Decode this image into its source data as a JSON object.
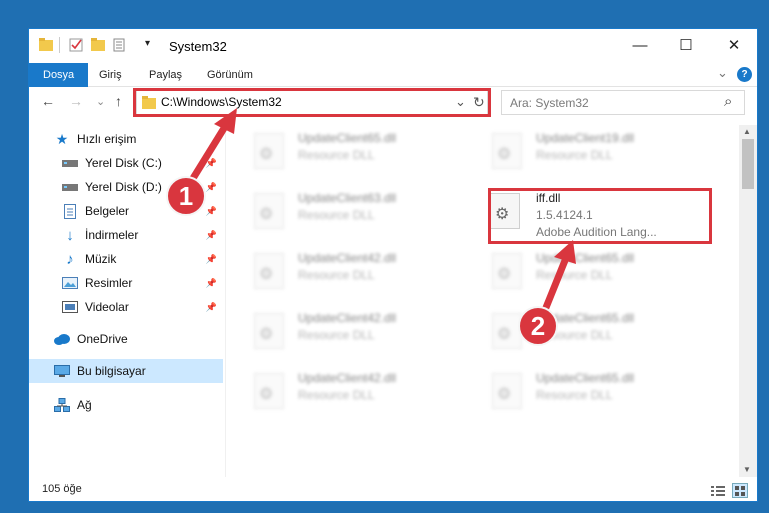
{
  "window": {
    "title": "System32",
    "minimize": "—",
    "maximize": "☐",
    "close": "✕"
  },
  "ribbon": {
    "tabs": [
      "Dosya",
      "Giriş",
      "Paylaş",
      "Görünüm"
    ],
    "expand": "⌄",
    "help": "?"
  },
  "nav": {
    "back": "←",
    "forward": "→",
    "recent": "⌄",
    "up": "↑",
    "address": "C:\\Windows\\System32",
    "dropdown": "⌄",
    "refresh": "↻",
    "search_placeholder": "Ara: System32",
    "search_icon": "⌕"
  },
  "sidebar": {
    "items": [
      {
        "label": "Hızlı erişim",
        "icon": "star-icon"
      },
      {
        "label": "Yerel Disk (C:)",
        "icon": "drive-icon"
      },
      {
        "label": "Yerel Disk (D:)",
        "icon": "drive-icon"
      },
      {
        "label": "Belgeler",
        "icon": "documents-icon"
      },
      {
        "label": "İndirmeler",
        "icon": "download-icon"
      },
      {
        "label": "Müzik",
        "icon": "music-icon"
      },
      {
        "label": "Resimler",
        "icon": "pictures-icon"
      },
      {
        "label": "Videolar",
        "icon": "video-icon"
      },
      {
        "label": "OneDrive",
        "icon": "cloud-icon"
      },
      {
        "label": "Bu bilgisayar",
        "icon": "computer-icon"
      },
      {
        "label": "Ağ",
        "icon": "network-icon"
      }
    ]
  },
  "files": {
    "left": [
      {
        "name": "UpdateClient65.dll",
        "desc": "Resource DLL"
      },
      {
        "name": "UpdateClient63.dll",
        "desc": "Resource DLL"
      },
      {
        "name": "UpdateClient42.dll",
        "desc": "Resource DLL"
      },
      {
        "name": "UpdateClient42.dll",
        "desc": "Resource DLL"
      },
      {
        "name": "UpdateClient42.dll",
        "desc": "Resource DLL"
      }
    ],
    "right": [
      {
        "name": "UpdateClient19.dll",
        "desc": "Resource DLL"
      },
      {
        "name": "UpdateClient65.dll",
        "desc": "Resource DLL"
      },
      {
        "name": "UpdateClient65.dll",
        "desc": "Resource DLL"
      },
      {
        "name": "UpdateClient65.dll",
        "desc": "Resource DLL"
      }
    ],
    "highlighted": {
      "name": "iff.dll",
      "version": "1.5.4124.1",
      "desc": "Adobe Audition Lang..."
    }
  },
  "status": {
    "count": "105 öğe"
  },
  "annotations": {
    "step1": "1",
    "step2": "2"
  },
  "colors": {
    "accent": "#1979ca",
    "highlight": "#d9363e",
    "selection": "#cce8ff"
  }
}
